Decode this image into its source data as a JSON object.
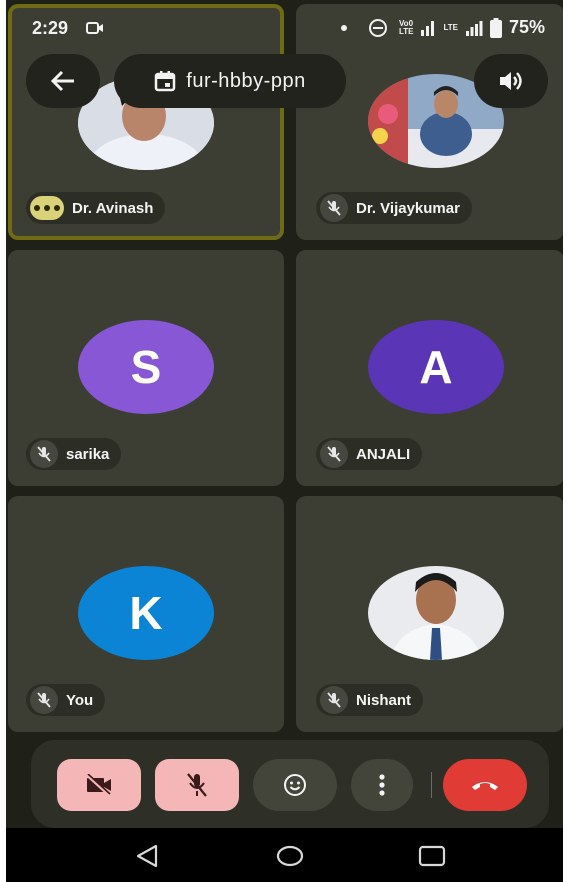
{
  "status_bar": {
    "time": "2:29",
    "volte_top": "Vo0",
    "volte_bottom": "LTE",
    "lte_top": "LTE",
    "lte_bottom": "",
    "battery": "75%"
  },
  "header": {
    "meeting_code": "fur-hbby-ppn"
  },
  "participants": [
    {
      "name": "Dr. Avinash",
      "initial": "",
      "muted": false,
      "speaking": true
    },
    {
      "name": "Dr. Vijaykumar",
      "initial": "",
      "muted": true
    },
    {
      "name": "sarika",
      "initial": "S",
      "muted": true,
      "color": "#8757d6"
    },
    {
      "name": "ANJALI",
      "initial": "A",
      "muted": true,
      "color": "#5a35b5"
    },
    {
      "name": "You",
      "initial": "K",
      "muted": true,
      "color": "#0b84d6"
    },
    {
      "name": "Nishant",
      "initial": "",
      "muted": true
    }
  ],
  "colors": {
    "background": "#1f2119",
    "tile": "#3c3e33",
    "active_border": "#6e6b14",
    "camera_off": "#f4b6b6",
    "end_call": "#e03b34"
  }
}
